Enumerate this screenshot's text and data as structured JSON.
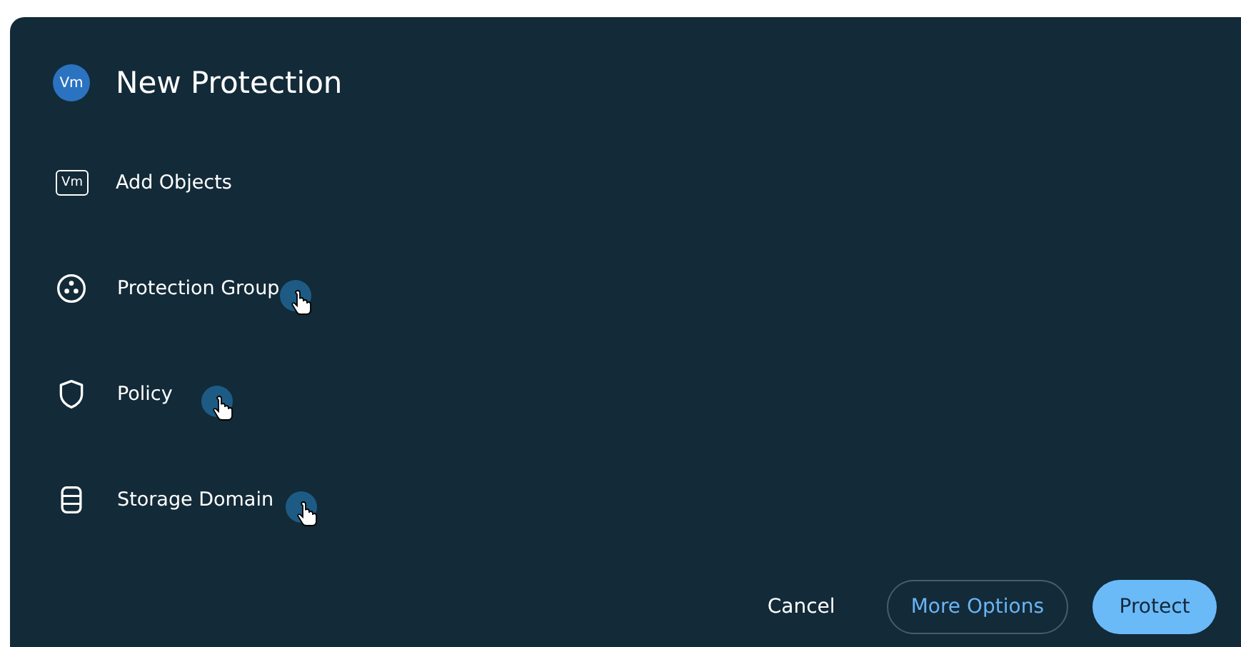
{
  "dialog": {
    "title": "New Protection",
    "badge": "Vm"
  },
  "items": [
    {
      "kind": "objects",
      "icon_text": "Vm",
      "label": "Add Objects",
      "hovered": false
    },
    {
      "kind": "group",
      "label": "Protection Group",
      "hovered": true
    },
    {
      "kind": "policy",
      "label": "Policy",
      "hovered": true
    },
    {
      "kind": "storage",
      "label": "Storage Domain",
      "hovered": true
    }
  ],
  "buttons": [
    {
      "kind": "text",
      "label": "Cancel"
    },
    {
      "kind": "outline",
      "label": "More Options"
    },
    {
      "kind": "primary",
      "label": "Protect"
    }
  ]
}
